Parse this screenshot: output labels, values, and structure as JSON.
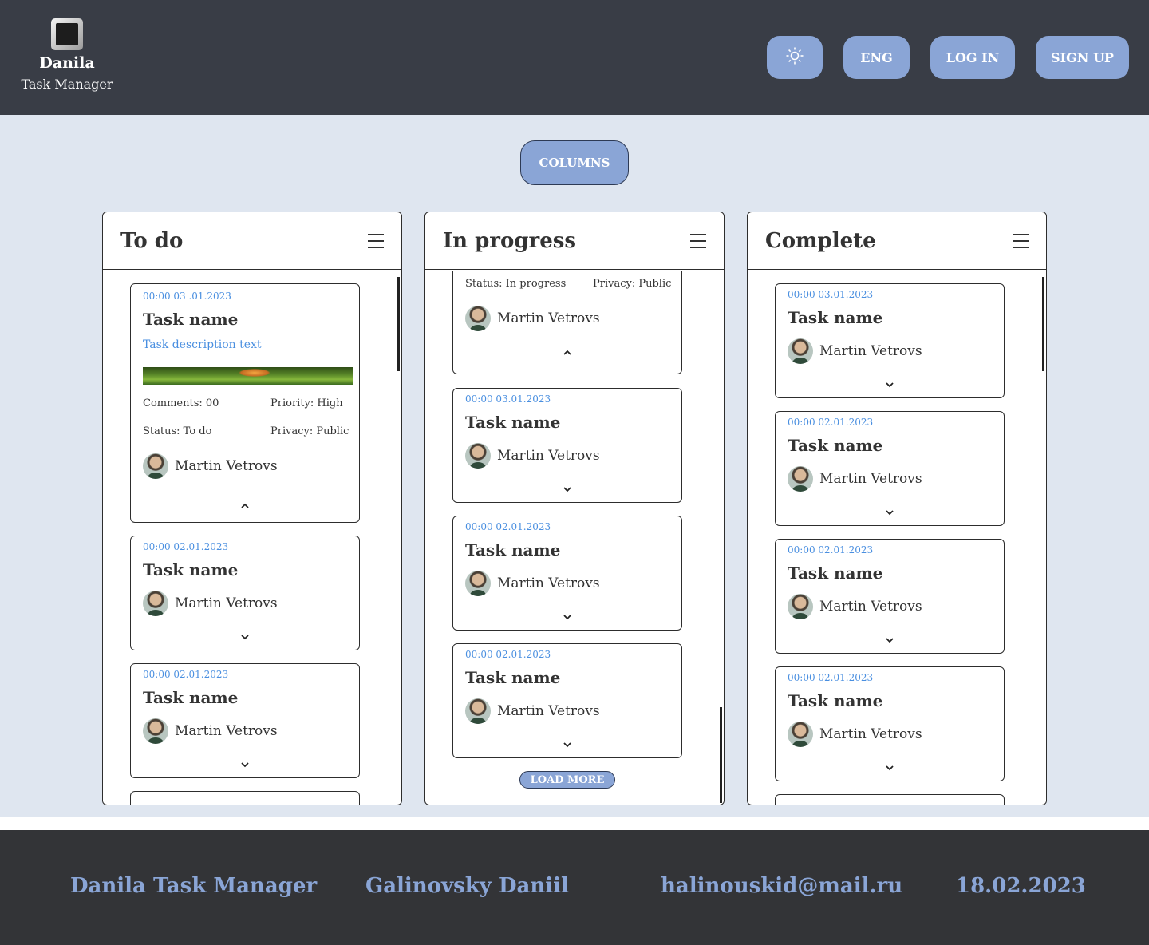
{
  "header": {
    "logo_title": "Danila",
    "logo_subtitle": "Task Manager",
    "theme_icon": "sun-icon",
    "lang_label": "ENG",
    "login_label": "LOG IN",
    "signup_label": "SIGN UP"
  },
  "main": {
    "columns_label": "COLUMNS",
    "columns": [
      {
        "title": "To do",
        "expanded": {
          "date": "00:00 03 .01.2023",
          "name": "Task name",
          "description": "Task description text",
          "comments": "Comments: 00",
          "priority": "Priority: High",
          "status": "Status: To do",
          "privacy": "Privacy: Public",
          "user": "Martin Vetrovs"
        },
        "cards": [
          {
            "date": "00:00 02.01.2023",
            "name": "Task name",
            "user": "Martin Vetrovs"
          },
          {
            "date": "00:00 02.01.2023",
            "name": "Task name",
            "user": "Martin Vetrovs"
          }
        ]
      },
      {
        "title": "In progress",
        "partial": {
          "status": "Status: In progress",
          "privacy": "Privacy: Public",
          "user": "Martin Vetrovs"
        },
        "cards": [
          {
            "date": "00:00 03.01.2023",
            "name": "Task name",
            "user": "Martin Vetrovs"
          },
          {
            "date": "00:00 02.01.2023",
            "name": "Task name",
            "user": "Martin Vetrovs"
          },
          {
            "date": "00:00 02.01.2023",
            "name": "Task name",
            "user": "Martin Vetrovs"
          }
        ],
        "load_more": "LOAD MORE"
      },
      {
        "title": "Complete",
        "cards": [
          {
            "date": "00:00 03.01.2023",
            "name": "Task name",
            "user": "Martin Vetrovs"
          },
          {
            "date": "00:00 02.01.2023",
            "name": "Task name",
            "user": "Martin Vetrovs"
          },
          {
            "date": "00:00 02.01.2023",
            "name": "Task name",
            "user": "Martin Vetrovs"
          },
          {
            "date": "00:00 02.01.2023",
            "name": "Task name",
            "user": "Martin Vetrovs"
          }
        ]
      }
    ]
  },
  "footer": {
    "app_name": "Danila Task Manager",
    "author": "Galinovsky Daniil",
    "email": "halinouskid@mail.ru",
    "date": "18.02.2023"
  },
  "colors": {
    "header_bg": "#393d46",
    "accent": "#8aa5d6",
    "page_bg": "#dfe6f0",
    "date_blue": "#4a8fe0",
    "footer_bg": "#333437"
  }
}
